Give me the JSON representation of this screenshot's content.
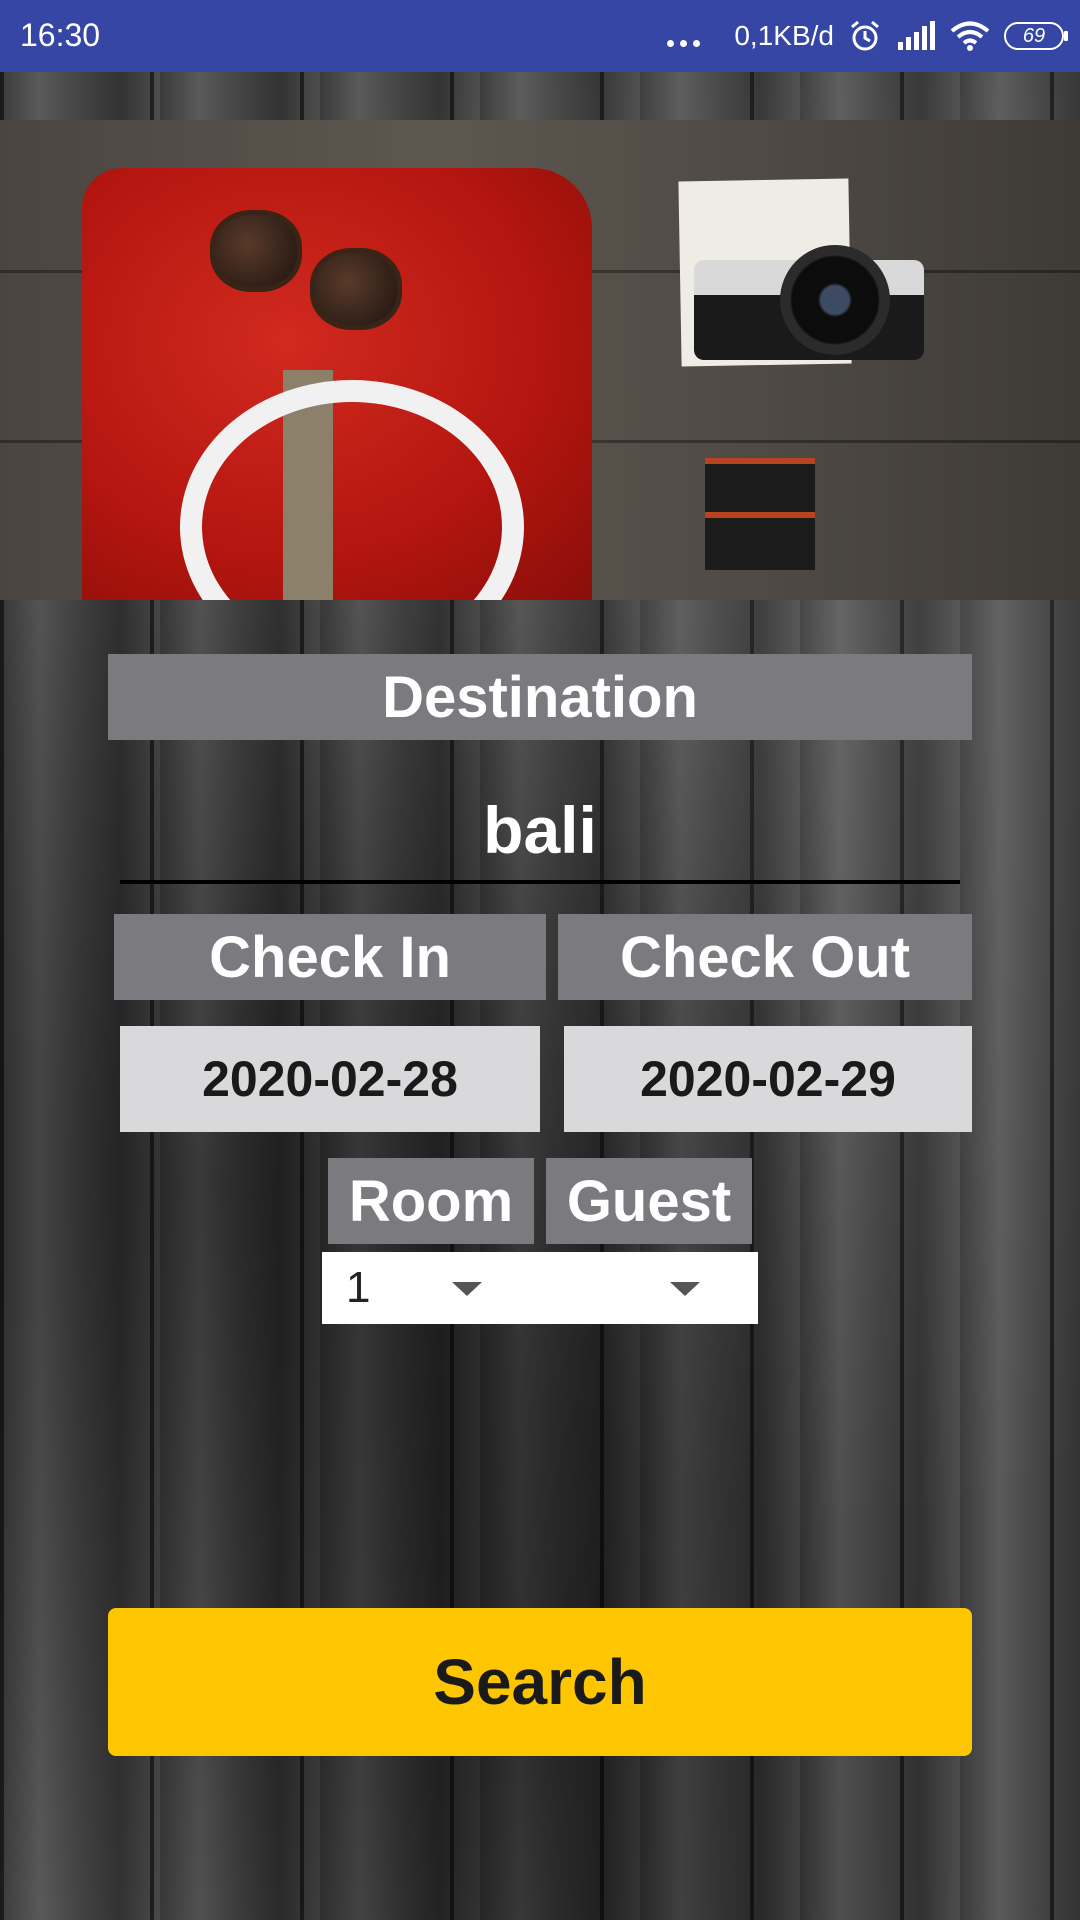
{
  "status_bar": {
    "time": "16:30",
    "network_speed": "0,1KB/d",
    "battery": "69",
    "icons": [
      "more-dots-icon",
      "alarm-icon",
      "signal-icon",
      "wifi-icon",
      "battery-icon"
    ]
  },
  "hero": {
    "image_semantic": "travel-flatlay-image"
  },
  "form": {
    "destination_label": "Destination",
    "destination_value": "bali",
    "checkin_label": "Check In",
    "checkout_label": "Check Out",
    "checkin_date": "2020-02-28",
    "checkout_date": "2020-02-29",
    "room_label": "Room",
    "guest_label": "Guest",
    "room_selected": "1",
    "guest_selected": ""
  },
  "actions": {
    "search_label": "Search"
  },
  "colors": {
    "status_bar": "#3646a4",
    "label_bg": "#7b7b7f",
    "date_bg": "#d9d9dc",
    "search_button": "#fdc600"
  }
}
